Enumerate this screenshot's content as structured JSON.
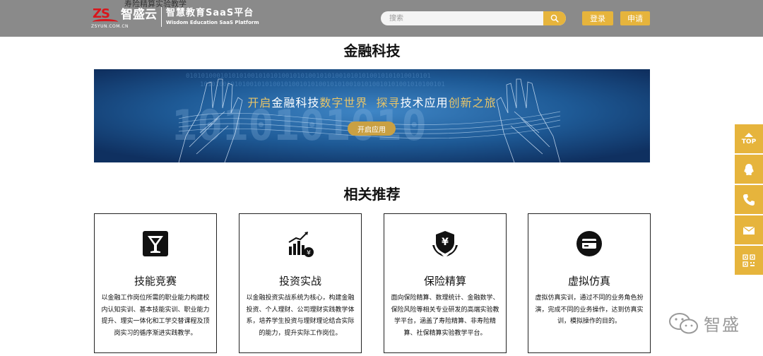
{
  "overlay_text": "寿险精算实验教学",
  "header": {
    "logo_mark": "ZS",
    "logo_cn": "智盛云",
    "logo_url": "ZSYUN.COM.CN",
    "logo_title": "智慧教育SaaS平台",
    "logo_en": "Wisdom Education SaaS Platform",
    "search_placeholder": "搜索",
    "login_label": "登录",
    "apply_label": "申请"
  },
  "fintech": {
    "title": "金融科技",
    "banner": {
      "slogan": [
        {
          "text": "开启",
          "style": "gold"
        },
        {
          "text": "金融科技",
          "style": "white"
        },
        {
          "text": "数字世界",
          "style": "gold"
        },
        {
          "text": "  探寻",
          "style": "gold"
        },
        {
          "text": "技术应用",
          "style": "white"
        },
        {
          "text": "创新之旅",
          "style": "gold"
        }
      ],
      "button_label": "开启应用"
    }
  },
  "recommend": {
    "title": "相关推荐",
    "cards": [
      {
        "title": "技能竞赛",
        "icon": "trophy-cup-icon",
        "desc": "以金融工作岗位所需的职业能力构建校内认知实训、基本技能实训、职业能力提升、理实一体化和工学交替课程及顶岗实习的循序渐进实践教学。"
      },
      {
        "title": "投资实战",
        "icon": "investment-chart-icon",
        "desc": "以金融投资实战系统为核心，构建金融投资、个人理财、公司理财实践教学体系，培养学生投资与理财理论结合实际的能力，提升实际工作岗位。"
      },
      {
        "title": "保险精算",
        "icon": "insurance-shield-icon",
        "desc": "面向保险精算、数理统计、金融数学、保险风险等相关专业研发的高端实验教学平台，涵盖了寿险精算、非寿险精算、社保精算实验教学平台。"
      },
      {
        "title": "虚拟仿真",
        "icon": "virtual-card-icon",
        "desc": "虚拟仿真实训，通过不同的业务角色扮演，完成不同的业务操作，达到仿真实训，模拟操作的目的。"
      }
    ]
  },
  "sidebar": {
    "top_label": "TOP",
    "items": [
      "back-to-top-icon",
      "qq-icon",
      "phone-icon",
      "mail-icon",
      "qr-code-icon"
    ]
  },
  "watermark": {
    "text": "智盛"
  },
  "colors": {
    "header_bg": "#8a8a8a",
    "accent": "#e6b43c",
    "brand_red": "#d9161c",
    "banner_blue": "#1e5a96"
  }
}
